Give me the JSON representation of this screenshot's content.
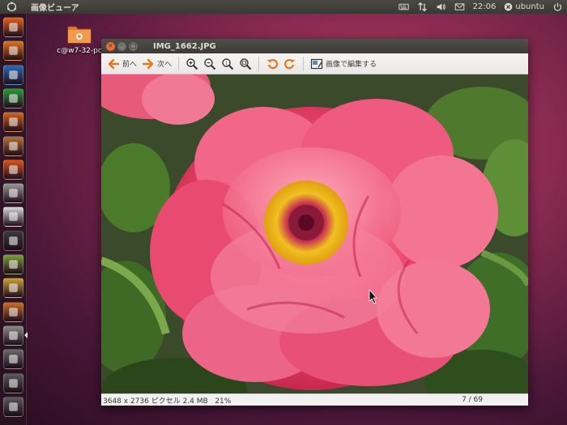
{
  "top_panel": {
    "app_name": "画像ビューア",
    "clock": "22:06",
    "user": "ubuntu"
  },
  "desktop": {
    "icon_label": "c@w7-32-pc"
  },
  "window": {
    "title": "IMG_1662.JPG",
    "toolbar": {
      "prev_label": "前へ",
      "next_label": "次へ",
      "edit_label": "画像で編集する"
    },
    "status": {
      "info": "3648 x 2736 ピクセル 2.4 MB   21%",
      "counter": "7 / 69"
    }
  },
  "launcher": {
    "items": [
      {
        "icon": "home-folder-icon",
        "color": "#e2631f"
      },
      {
        "icon": "firefox-icon",
        "color": "#e8731c"
      },
      {
        "icon": "writer-icon",
        "color": "#2a6cb8"
      },
      {
        "icon": "calc-icon",
        "color": "#2a9a3c"
      },
      {
        "icon": "impress-icon",
        "color": "#d4661e"
      },
      {
        "icon": "software-center-icon",
        "color": "#b5703a"
      },
      {
        "icon": "ubuntu-one-icon",
        "color": "#d9531e"
      },
      {
        "icon": "camera-icon",
        "color": "#9a9a9a"
      },
      {
        "icon": "text-editor-icon",
        "color": "#d9d9d9"
      },
      {
        "icon": "terminal-icon",
        "color": "#3a3a3a"
      },
      {
        "icon": "tools-icon",
        "color": "#7aa03a"
      },
      {
        "icon": "pencils-icon",
        "color": "#c9a23a"
      },
      {
        "icon": "update-icon",
        "color": "#c9702a"
      },
      {
        "icon": "image-viewer-icon",
        "color": "#8a8a8a"
      },
      {
        "icon": "workspace-switcher-icon",
        "color": "#6a6a6a"
      },
      {
        "icon": "disk-icon",
        "color": "#5a5a5a"
      },
      {
        "icon": "optical-disk-icon",
        "color": "#5a5a5a"
      }
    ]
  },
  "colors": {
    "panel": "#3c3b37",
    "accent": "#e2631f"
  }
}
